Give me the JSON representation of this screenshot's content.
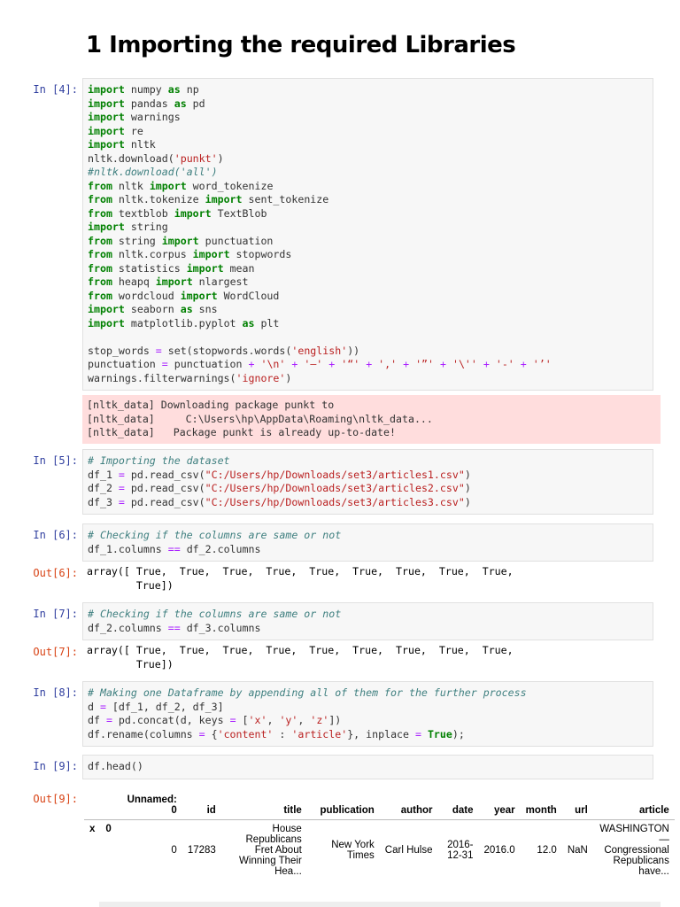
{
  "heading": "1 Importing the required Libraries",
  "cells": [
    {
      "prompt": "In [4]:",
      "lines": [
        [
          [
            "kw",
            "import"
          ],
          [
            "t",
            " numpy "
          ],
          [
            "kw",
            "as"
          ],
          [
            "t",
            " np"
          ]
        ],
        [
          [
            "kw",
            "import"
          ],
          [
            "t",
            " pandas "
          ],
          [
            "kw",
            "as"
          ],
          [
            "t",
            " pd"
          ]
        ],
        [
          [
            "kw",
            "import"
          ],
          [
            "t",
            " warnings"
          ]
        ],
        [
          [
            "kw",
            "import"
          ],
          [
            "t",
            " re"
          ]
        ],
        [
          [
            "kw",
            "import"
          ],
          [
            "t",
            " nltk"
          ]
        ],
        [
          [
            "t",
            "nltk.download("
          ],
          [
            "str",
            "'punkt'"
          ],
          [
            "t",
            ")"
          ]
        ],
        [
          [
            "cm",
            "#nltk.download('all')"
          ]
        ],
        [
          [
            "kw",
            "from"
          ],
          [
            "t",
            " nltk "
          ],
          [
            "kw",
            "import"
          ],
          [
            "t",
            " word_tokenize"
          ]
        ],
        [
          [
            "kw",
            "from"
          ],
          [
            "t",
            " nltk.tokenize "
          ],
          [
            "kw",
            "import"
          ],
          [
            "t",
            " sent_tokenize"
          ]
        ],
        [
          [
            "kw",
            "from"
          ],
          [
            "t",
            " textblob "
          ],
          [
            "kw",
            "import"
          ],
          [
            "t",
            " TextBlob"
          ]
        ],
        [
          [
            "kw",
            "import"
          ],
          [
            "t",
            " string"
          ]
        ],
        [
          [
            "kw",
            "from"
          ],
          [
            "t",
            " string "
          ],
          [
            "kw",
            "import"
          ],
          [
            "t",
            " punctuation"
          ]
        ],
        [
          [
            "kw",
            "from"
          ],
          [
            "t",
            " nltk.corpus "
          ],
          [
            "kw",
            "import"
          ],
          [
            "t",
            " stopwords"
          ]
        ],
        [
          [
            "kw",
            "from"
          ],
          [
            "t",
            " statistics "
          ],
          [
            "kw",
            "import"
          ],
          [
            "t",
            " mean"
          ]
        ],
        [
          [
            "kw",
            "from"
          ],
          [
            "t",
            " heapq "
          ],
          [
            "kw",
            "import"
          ],
          [
            "t",
            " nlargest"
          ]
        ],
        [
          [
            "kw",
            "from"
          ],
          [
            "t",
            " wordcloud "
          ],
          [
            "kw",
            "import"
          ],
          [
            "t",
            " WordCloud"
          ]
        ],
        [
          [
            "kw",
            "import"
          ],
          [
            "t",
            " seaborn "
          ],
          [
            "kw",
            "as"
          ],
          [
            "t",
            " sns"
          ]
        ],
        [
          [
            "kw",
            "import"
          ],
          [
            "t",
            " matplotlib.pyplot "
          ],
          [
            "kw",
            "as"
          ],
          [
            "t",
            " plt"
          ]
        ],
        [
          [
            "t",
            ""
          ]
        ],
        [
          [
            "t",
            "stop_words "
          ],
          [
            "op",
            "="
          ],
          [
            "t",
            " set(stopwords.words("
          ],
          [
            "str",
            "'english'"
          ],
          [
            "t",
            "))"
          ]
        ],
        [
          [
            "t",
            "punctuation "
          ],
          [
            "op",
            "="
          ],
          [
            "t",
            " punctuation "
          ],
          [
            "op",
            "+"
          ],
          [
            "t",
            " "
          ],
          [
            "str",
            "'\\n'"
          ],
          [
            "t",
            " "
          ],
          [
            "op",
            "+"
          ],
          [
            "t",
            " "
          ],
          [
            "str",
            "'—'"
          ],
          [
            "t",
            " "
          ],
          [
            "op",
            "+"
          ],
          [
            "t",
            " "
          ],
          [
            "str",
            "'“'"
          ],
          [
            "t",
            " "
          ],
          [
            "op",
            "+"
          ],
          [
            "t",
            " "
          ],
          [
            "str",
            "','"
          ],
          [
            "t",
            " "
          ],
          [
            "op",
            "+"
          ],
          [
            "t",
            " "
          ],
          [
            "str",
            "'”'"
          ],
          [
            "t",
            " "
          ],
          [
            "op",
            "+"
          ],
          [
            "t",
            " "
          ],
          [
            "str",
            "'\\''"
          ],
          [
            "t",
            " "
          ],
          [
            "op",
            "+"
          ],
          [
            "t",
            " "
          ],
          [
            "str",
            "'-'"
          ],
          [
            "t",
            " "
          ],
          [
            "op",
            "+"
          ],
          [
            "t",
            " "
          ],
          [
            "str",
            "'’'"
          ]
        ],
        [
          [
            "t",
            "warnings.filterwarnings("
          ],
          [
            "str",
            "'ignore'"
          ],
          [
            "t",
            ")"
          ]
        ]
      ],
      "stderr": [
        "[nltk_data] Downloading package punkt to",
        "[nltk_data]     C:\\Users\\hp\\AppData\\Roaming\\nltk_data...",
        "[nltk_data]   Package punkt is already up-to-date!"
      ]
    },
    {
      "prompt": "In [5]:",
      "lines": [
        [
          [
            "cm",
            "# Importing the dataset"
          ]
        ],
        [
          [
            "t",
            "df_1 "
          ],
          [
            "op",
            "="
          ],
          [
            "t",
            " pd.read_csv("
          ],
          [
            "str",
            "\"C:/Users/hp/Downloads/set3/articles1.csv\""
          ],
          [
            "t",
            ")"
          ]
        ],
        [
          [
            "t",
            "df_2 "
          ],
          [
            "op",
            "="
          ],
          [
            "t",
            " pd.read_csv("
          ],
          [
            "str",
            "\"C:/Users/hp/Downloads/set3/articles2.csv\""
          ],
          [
            "t",
            ")"
          ]
        ],
        [
          [
            "t",
            "df_3 "
          ],
          [
            "op",
            "="
          ],
          [
            "t",
            " pd.read_csv("
          ],
          [
            "str",
            "\"C:/Users/hp/Downloads/set3/articles3.csv\""
          ],
          [
            "t",
            ")"
          ]
        ]
      ]
    },
    {
      "prompt": "In [6]:",
      "lines": [
        [
          [
            "cm",
            "# Checking if the columns are same or not"
          ]
        ],
        [
          [
            "t",
            "df_1.columns "
          ],
          [
            "op",
            "=="
          ],
          [
            "t",
            " df_2.columns"
          ]
        ]
      ],
      "out_prompt": "Out[6]:",
      "output": "array([ True,  True,  True,  True,  True,  True,  True,  True,  True,\n        True])"
    },
    {
      "prompt": "In [7]:",
      "lines": [
        [
          [
            "cm",
            "# Checking if the columns are same or not"
          ]
        ],
        [
          [
            "t",
            "df_2.columns "
          ],
          [
            "op",
            "=="
          ],
          [
            "t",
            " df_3.columns"
          ]
        ]
      ],
      "out_prompt": "Out[7]:",
      "output": "array([ True,  True,  True,  True,  True,  True,  True,  True,  True,\n        True])"
    },
    {
      "prompt": "In [8]:",
      "lines": [
        [
          [
            "cm",
            "# Making one Dataframe by appending all of them for the further process"
          ]
        ],
        [
          [
            "t",
            "d "
          ],
          [
            "op",
            "="
          ],
          [
            "t",
            " [df_1, df_2, df_3]"
          ]
        ],
        [
          [
            "t",
            "df "
          ],
          [
            "op",
            "="
          ],
          [
            "t",
            " pd.concat(d, keys "
          ],
          [
            "op",
            "="
          ],
          [
            "t",
            " ["
          ],
          [
            "str",
            "'x'"
          ],
          [
            "t",
            ", "
          ],
          [
            "str",
            "'y'"
          ],
          [
            "t",
            ", "
          ],
          [
            "str",
            "'z'"
          ],
          [
            "t",
            "])"
          ]
        ],
        [
          [
            "t",
            "df.rename(columns "
          ],
          [
            "op",
            "="
          ],
          [
            "t",
            " {"
          ],
          [
            "str",
            "'content'"
          ],
          [
            "t",
            " : "
          ],
          [
            "str",
            "'article'"
          ],
          [
            "t",
            "}, inplace "
          ],
          [
            "op",
            "="
          ],
          [
            "t",
            " "
          ],
          [
            "kw",
            "True"
          ],
          [
            "t",
            ");"
          ]
        ]
      ]
    },
    {
      "prompt": "In [9]:",
      "lines": [
        [
          [
            "t",
            "df.head()"
          ]
        ]
      ],
      "out_prompt": "Out[9]:"
    }
  ],
  "table": {
    "headers": [
      "",
      "",
      "Unnamed: 0",
      "id",
      "title",
      "publication",
      "author",
      "date",
      "year",
      "month",
      "url",
      "article"
    ],
    "rows": [
      [
        "x",
        "0",
        "0",
        "17283",
        "House Republicans Fret About Winning Their Hea...",
        "New York Times",
        "Carl Hulse",
        "2016-12-31",
        "2016.0",
        "12.0",
        "NaN",
        "WASHINGTON — Congressional Republicans have..."
      ]
    ]
  }
}
